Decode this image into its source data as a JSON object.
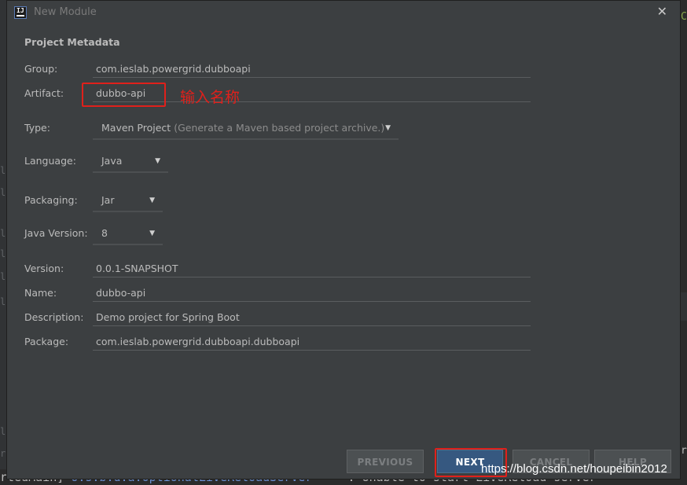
{
  "background": {
    "right_glyph": "C",
    "right_glyph2": "r",
    "left_gutter": [
      "l",
      "l",
      "l",
      "l",
      "l",
      "l",
      "l",
      "r"
    ],
    "console": {
      "prefix": "rtedMain] ",
      "logger": "o.s.b.d.a.OptionalLiveReloadServer",
      "message": "     : Unable to start LiveReload server"
    }
  },
  "dialog": {
    "title": "New Module",
    "app_icon_text": "IJ",
    "close_glyph": "✕",
    "section_title": "Project Metadata",
    "fields": {
      "group": {
        "label": "Group:",
        "value": "com.ieslab.powergrid.dubboapi"
      },
      "artifact": {
        "label": "Artifact:",
        "value": "dubbo-api"
      },
      "type": {
        "label": "Type:",
        "value": "Maven Project",
        "hint": "(Generate a Maven based project archive.)"
      },
      "language": {
        "label": "Language:",
        "value": "Java"
      },
      "packaging": {
        "label": "Packaging:",
        "value": "Jar"
      },
      "java_version": {
        "label": "Java Version:",
        "value": "8"
      },
      "version": {
        "label": "Version:",
        "value": "0.0.1-SNAPSHOT"
      },
      "name": {
        "label": "Name:",
        "value": "dubbo-api"
      },
      "description": {
        "label": "Description:",
        "value": "Demo project for Spring Boot"
      },
      "package": {
        "label": "Package:",
        "value": "com.ieslab.powergrid.dubboapi.dubboapi"
      }
    },
    "annotation": "输入名称",
    "buttons": {
      "previous": "PREVIOUS",
      "next": "NEXT",
      "cancel": "CANCEL",
      "help": "HELP"
    }
  },
  "watermark": "https://blog.csdn.net/houpeibin2012",
  "colors": {
    "dialog_bg": "#3c3f41",
    "highlight_red": "#e0201b",
    "primary_button": "#365880"
  }
}
